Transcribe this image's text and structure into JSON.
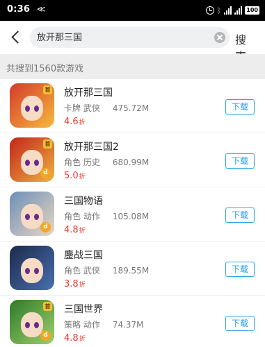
{
  "status_bar": {
    "time": "0:36",
    "left_icon": "≪",
    "battery": "100"
  },
  "search": {
    "value": "放开那三国",
    "button_label": "搜 索"
  },
  "result_count_text": "共搜到1560款游戏",
  "download_label": "下载",
  "discount_unit": "折",
  "games": [
    {
      "name": "放开那三国",
      "tags": "卡牌 武侠",
      "size": "475.72M",
      "discount": "4.6",
      "icon": "game-icon-1",
      "badge": "首",
      "has_logo": false,
      "colors": [
        "#d43b2a",
        "#f7b83d"
      ]
    },
    {
      "name": "放开那三国2",
      "tags": "角色 历史",
      "size": "680.99M",
      "discount": "5.0",
      "icon": "game-icon-2",
      "badge": "首",
      "has_logo": true,
      "colors": [
        "#c2261b",
        "#f0b040"
      ]
    },
    {
      "name": "三国物语",
      "tags": "角色 动作",
      "size": "105.08M",
      "discount": "4.8",
      "icon": "game-icon-3",
      "badge": "",
      "has_logo": true,
      "colors": [
        "#6c8fb8",
        "#e8d7c2"
      ]
    },
    {
      "name": "鏖战三国",
      "tags": "角色 武侠",
      "size": "189.55M",
      "discount": "3.8",
      "icon": "game-icon-4",
      "badge": "",
      "has_logo": false,
      "colors": [
        "#1b2a4a",
        "#4a6fb0"
      ]
    },
    {
      "name": "三国世界",
      "tags": "策略 动作",
      "size": "74.37M",
      "discount": "4.8",
      "icon": "game-icon-5",
      "badge": "首",
      "has_logo": true,
      "colors": [
        "#2d7a2a",
        "#9ed06a"
      ]
    }
  ]
}
